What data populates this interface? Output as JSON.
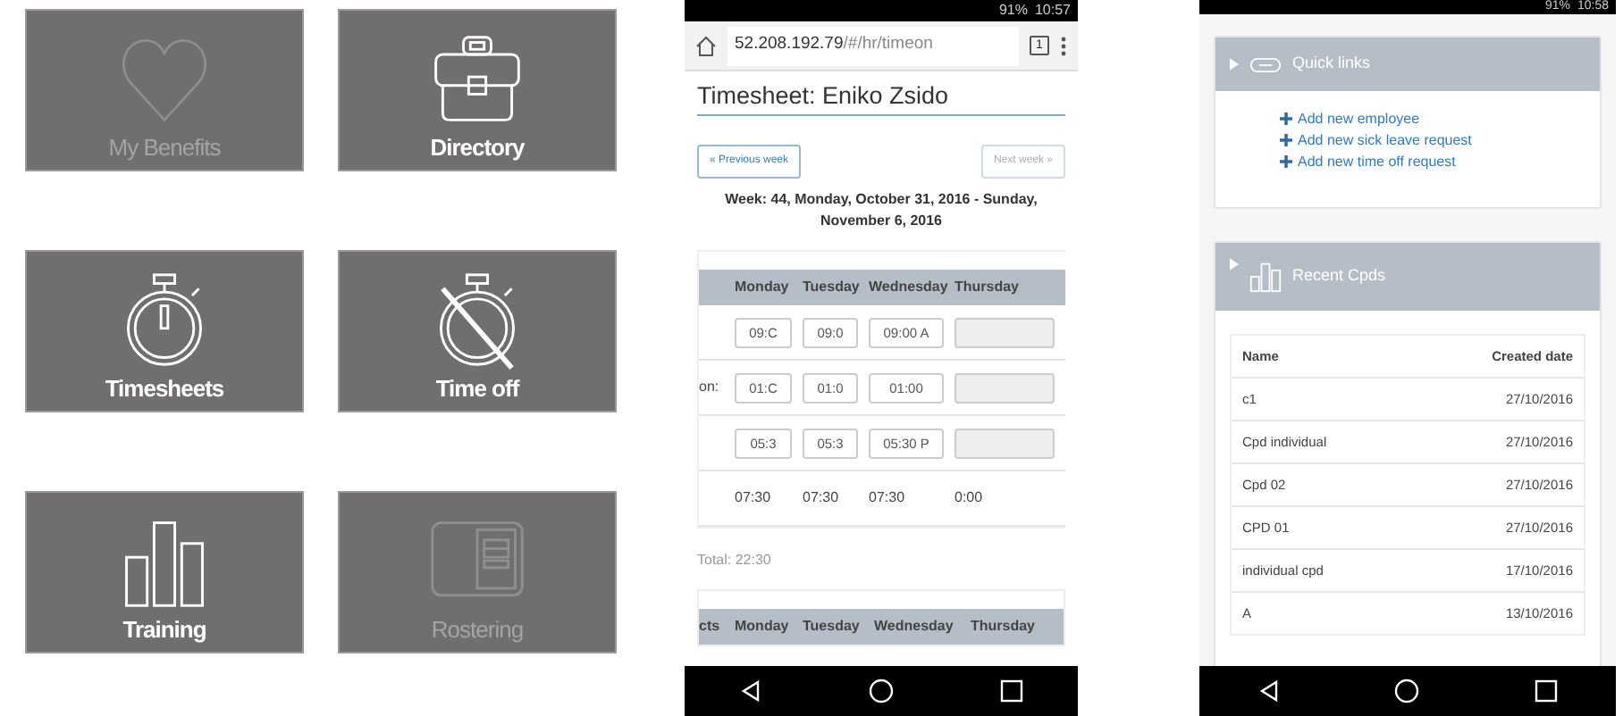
{
  "tiles": [
    {
      "label": "My Benefits",
      "kind": "heart",
      "enabled": false
    },
    {
      "label": "Directory",
      "kind": "briefcase",
      "enabled": true
    },
    {
      "label": "Timesheets",
      "kind": "stopwatch",
      "enabled": true
    },
    {
      "label": "Time off",
      "kind": "stopwatch-off",
      "enabled": true
    },
    {
      "label": "Training",
      "kind": "bars",
      "enabled": true
    },
    {
      "label": "Rostering",
      "kind": "roster",
      "enabled": false
    }
  ],
  "phone_1": {
    "status_bar": {
      "battery": "91%",
      "time": "10:57"
    },
    "address_bar": {
      "host": "52.208.192.79",
      "path": "/#/hr/timeon",
      "tab_count": "1"
    },
    "title": "Timesheet: Eniko Zsido",
    "prev_button": {
      "label": "« Previous week",
      "disabled": false
    },
    "next_button": {
      "label": "Next week »",
      "disabled": true
    },
    "week": "Week: 44, Monday, October 31, 2016 - Sunday, November 6, 2016",
    "table": {
      "columns": [
        "Monday",
        "Tuesday",
        "Wednesday",
        "Thursday"
      ],
      "rows": [
        {
          "label": "",
          "cells": [
            {
              "value": "09:C",
              "disabled": false
            },
            {
              "value": "09:0",
              "disabled": false
            },
            {
              "value": "09:00 A",
              "disabled": false
            },
            {
              "disabled": true
            }
          ]
        },
        {
          "label": "on:",
          "cells": [
            {
              "value": "01:C",
              "disabled": false
            },
            {
              "value": "01:0",
              "disabled": false
            },
            {
              "value": "01:00",
              "disabled": false
            },
            {
              "disabled": true
            }
          ]
        },
        {
          "label": "",
          "cells": [
            {
              "value": "05:3",
              "disabled": false
            },
            {
              "value": "05:3",
              "disabled": false
            },
            {
              "value": "05:30 P",
              "disabled": false
            },
            {
              "disabled": true
            }
          ]
        }
      ],
      "totals": [
        "07:30",
        "07:30",
        "07:30",
        "0:00"
      ]
    },
    "total": "Total: 22:30",
    "table_2": {
      "columns": [
        "cts",
        "Monday",
        "Tuesday",
        "Wednesday",
        "Thursday"
      ]
    }
  },
  "phone_2": {
    "status_bar": {
      "battery": "91%",
      "time": "10:58"
    },
    "quick_links": {
      "title": "Quick links",
      "links": [
        "Add new employee",
        "Add new sick leave request",
        "Add new time off request"
      ]
    },
    "recent_cpds": {
      "title": "Recent Cpds",
      "columns": [
        "Name",
        "Created date"
      ],
      "rows": [
        [
          "c1",
          "27/10/2016"
        ],
        [
          "Cpd individual",
          "27/10/2016"
        ],
        [
          "Cpd 02",
          "27/10/2016"
        ],
        [
          "CPD 01",
          "27/10/2016"
        ],
        [
          "individual cpd",
          "17/10/2016"
        ],
        [
          "A",
          "13/10/2016"
        ]
      ]
    }
  }
}
